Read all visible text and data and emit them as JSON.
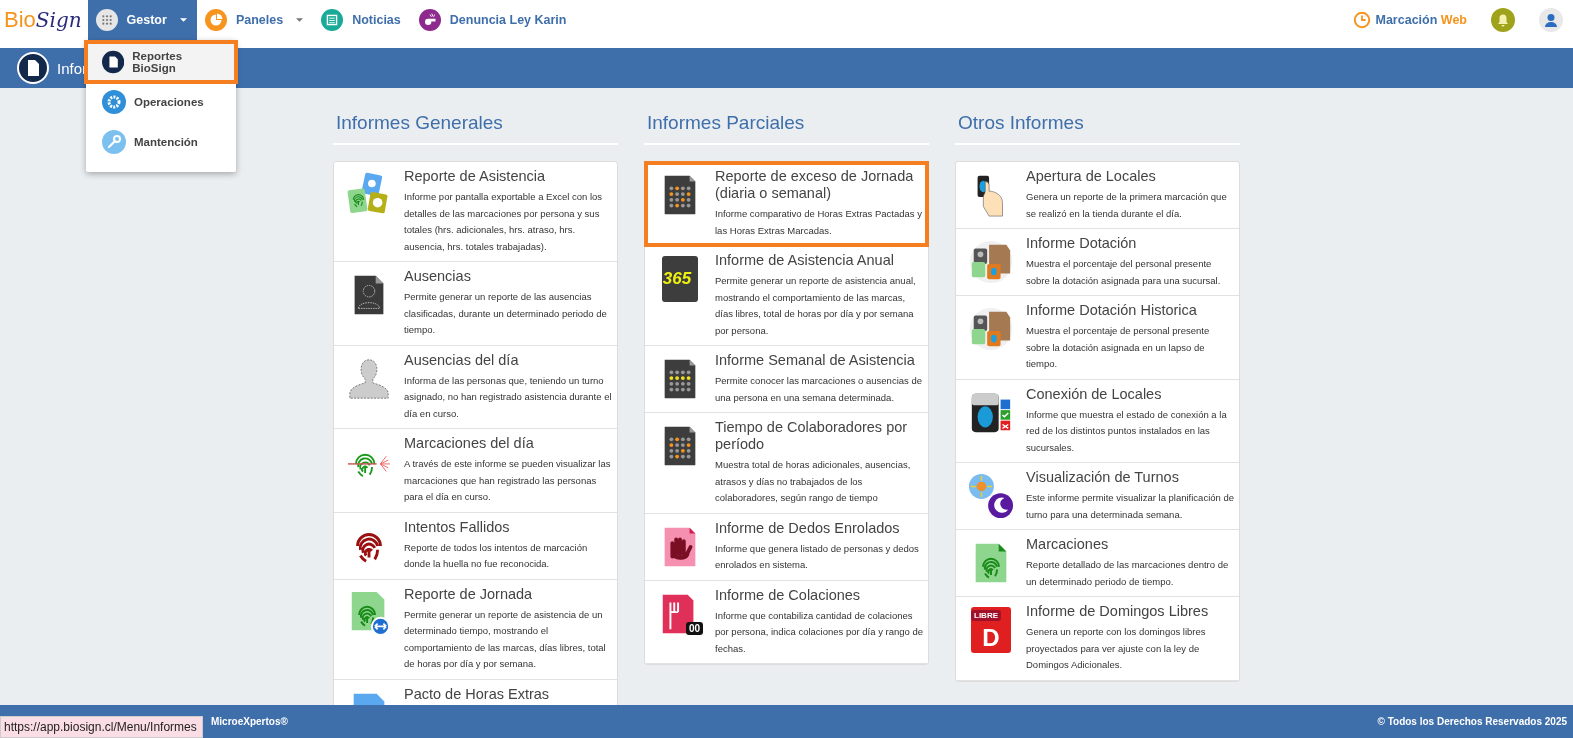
{
  "logo": {
    "first": "Bio",
    "second": "Sign"
  },
  "nav": [
    {
      "kind": "grid",
      "label": "Gestor",
      "selected": true,
      "dropdown": true
    },
    {
      "kind": "pie",
      "label": "Paneles",
      "selected": false,
      "dropdown": true
    },
    {
      "kind": "news",
      "label": "Noticias",
      "selected": false,
      "dropdown": false
    },
    {
      "kind": "whistle",
      "label": "Denuncia Ley Karin",
      "selected": false,
      "dropdown": false
    }
  ],
  "marcacion": {
    "first": "Marcación",
    "second": "Web"
  },
  "menu": [
    {
      "kind": "doc",
      "label": "Reportes BioSign",
      "selected": true,
      "highlighted": true
    },
    {
      "kind": "gear",
      "label": "Operaciones",
      "selected": false,
      "highlighted": false
    },
    {
      "kind": "wrench",
      "label": "Mantención",
      "selected": false,
      "highlighted": false
    }
  ],
  "page_title": "Infor",
  "columns": [
    {
      "title": "Informes Generales",
      "items": [
        {
          "kind": "collage",
          "title": "Reporte de Asistencia",
          "description": "Informe por pantalla exportable a Excel con los detalles de las marcaciones por persona y sus totales (hrs. adicionales, hrs. atraso, hrs. ausencia, hrs. totales trabajadas).",
          "highlighted": false
        },
        {
          "kind": "person-doc",
          "title": "Ausencias",
          "description": "Permite generar un reporte de las ausencias clasificadas, durante un determinado periodo de tiempo.",
          "highlighted": false
        },
        {
          "kind": "silhouette",
          "title": "Ausencias del día",
          "description": "Informa de las personas que, teniendo un turno asignado, no han registrado asistencia durante el día en curso.",
          "highlighted": false
        },
        {
          "kind": "scan",
          "title": "Marcaciones del día",
          "description": "A través de este informe se pueden visualizar las marcaciones que han registrado las personas para el día en curso.",
          "highlighted": false
        },
        {
          "kind": "fingerprint",
          "title": "Intentos Fallidos",
          "description": "Reporte de todos los intentos de marcación donde la huella no fue reconocida.",
          "highlighted": false
        },
        {
          "kind": "fp-arrow",
          "title": "Reporte de Jornada",
          "description": "Permite generar un reporte de asistencia de un determinado tiempo, mostrando el comportamiento de las marcas, días libres, total de horas por día y por semana.",
          "highlighted": false
        },
        {
          "kind": "blue-doc",
          "title": "Pacto de Horas Extras",
          "highlighted": false
        }
      ]
    },
    {
      "title": "Informes Parciales",
      "items": [
        {
          "kind": "dots-orange",
          "title": "Reporte de exceso de Jornada (diaria o semanal)",
          "description": "Informe comparativo de Horas Extras Pactadas y las Horas Extras Marcadas.",
          "highlighted": true
        },
        {
          "kind": "year",
          "icon_text": "365",
          "title": "Informe de Asistencia Anual",
          "description": "Permite generar un reporte de asistencia anual, mostrando el comportamiento de las marcas, días libres, total de horas por día y por semana por persona.",
          "highlighted": false
        },
        {
          "kind": "dots-yellow",
          "title": "Informe Semanal de Asistencia",
          "description": "Permite conocer las marcaciones o ausencias de una persona en una semana determinada.",
          "highlighted": false
        },
        {
          "kind": "dots-orange",
          "title": "Tiempo de Colaboradores por período",
          "description": "Muestra total de horas adicionales, ausencias, atrasos y días no trabajados de los colaboradores, según rango de tiempo",
          "highlighted": false
        },
        {
          "kind": "hand-doc",
          "title": "Informe de Dedos Enrolados",
          "description": "Informe que genera listado de personas y dedos enrolados en sistema.",
          "highlighted": false
        },
        {
          "kind": "meal-doc",
          "icon_text": "00",
          "title": "Informe de Colaciones",
          "description": "Informe que contabiliza cantidad de colaciones por persona, indica colaciones por día y rango de fechas.",
          "highlighted": false
        }
      ]
    },
    {
      "title": "Otros Informes",
      "items": [
        {
          "kind": "touch",
          "title": "Apertura de Locales",
          "description": "Genera un reporte de la primera marcación que se realizó en la tienda durante el día.",
          "highlighted": false
        },
        {
          "kind": "boxes",
          "title": "Informe Dotación",
          "description": "Muestra el porcentaje del personal presente sobre la dotación asignada para una sucursal.",
          "highlighted": false
        },
        {
          "kind": "boxes",
          "title": "Informe Dotación Historica",
          "description": "Muestra el porcentaje de personal presente sobre la dotación asignada en un lapso de tiempo.",
          "highlighted": false
        },
        {
          "kind": "device",
          "title": "Conexión de Locales",
          "description": "Informe que muestra el estado de conexión a la red de los distintos puntos instalados en las sucursales.",
          "highlighted": false
        },
        {
          "kind": "sun-moon",
          "title": "Visualización de Turnos",
          "description": "Este informe permite visualizar la planificación de turno para una determinada semana.",
          "highlighted": false
        },
        {
          "kind": "fp-doc",
          "title": "Marcaciones",
          "description": "Reporte detallado de las marcaciones dentro de un determinado periodo de tiempo.",
          "highlighted": false
        },
        {
          "kind": "libre",
          "icon_label": "LIBRE",
          "icon_text": "D",
          "title": "Informe de Domingos Libres",
          "description": "Genera un reporte con los domingos libres proyectados para ver ajuste con la ley de Domingos Adicionales.",
          "highlighted": false
        }
      ]
    }
  ],
  "footer": {
    "left": "MicroeXpertos®",
    "right": "© Todos los Derechos Reservados 2025"
  },
  "status_url": "https://app.biosign.cl/Menu/Informes"
}
